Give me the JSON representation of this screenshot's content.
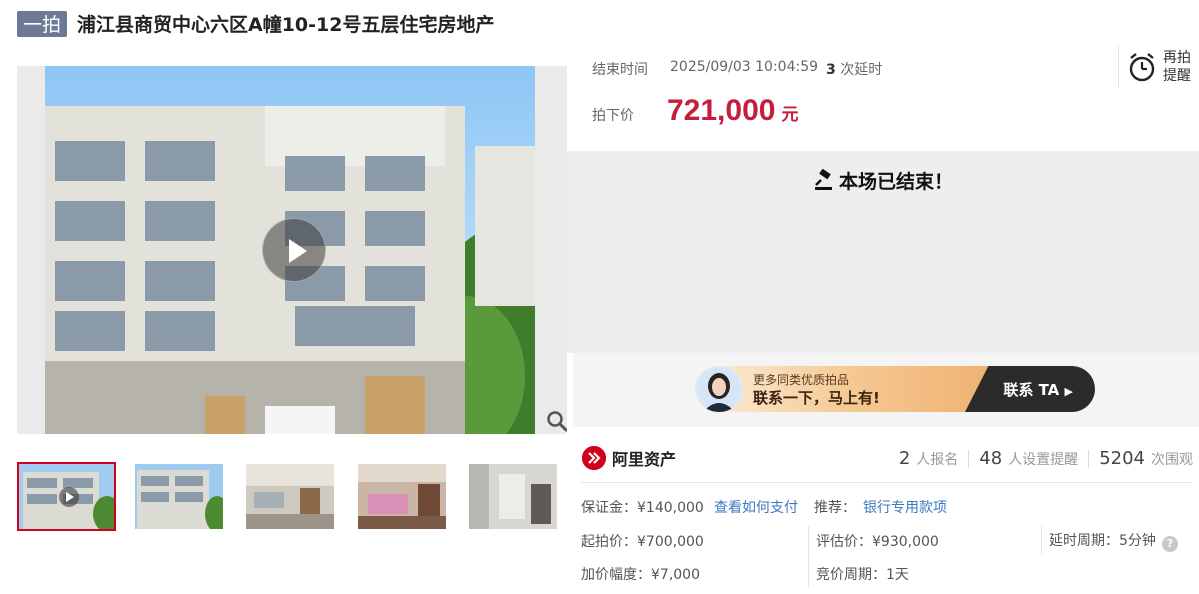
{
  "header": {
    "badge": "一拍",
    "title": "浦江县商贸中心六区A幢10-12号五层住宅房地产"
  },
  "auction": {
    "end_label": "结束时间",
    "end_time": "2025/09/03 10:04:59",
    "delay_count": "3",
    "delay_suffix": "次延时",
    "remind_line1": "再拍",
    "remind_line2": "提醒",
    "price_label": "拍下价",
    "price": "721,000",
    "price_unit": "元",
    "status": "本场已结束！"
  },
  "banner": {
    "line1": "更多同类优质拍品",
    "line2": "联系一下，马上有!",
    "cta": "联系 TA"
  },
  "brand": {
    "name": "阿里资产"
  },
  "stats": [
    {
      "n": "2",
      "label": "人报名"
    },
    {
      "n": "48",
      "label": "人设置提醒"
    },
    {
      "n": "5204",
      "label": "次围观"
    }
  ],
  "info": {
    "deposit": "保证金：¥140,000",
    "pay_link": "查看如何支付",
    "recommend_label": "推荐：",
    "recommend_link": "银行专用款项",
    "start_price": "起拍价：¥700,000",
    "appraisal": "评估价：¥930,000",
    "delay_period": "延时周期：5分钟",
    "increment": "加价幅度：¥7,000",
    "bid_period": "竞价周期：1天"
  },
  "colors": {
    "accent": "#c41e3a",
    "badge": "#6d7a96",
    "link": "#3b79c2"
  },
  "icons": [
    "play-icon",
    "zoom-icon",
    "alarm-clock-icon",
    "gavel-icon",
    "info-icon"
  ]
}
